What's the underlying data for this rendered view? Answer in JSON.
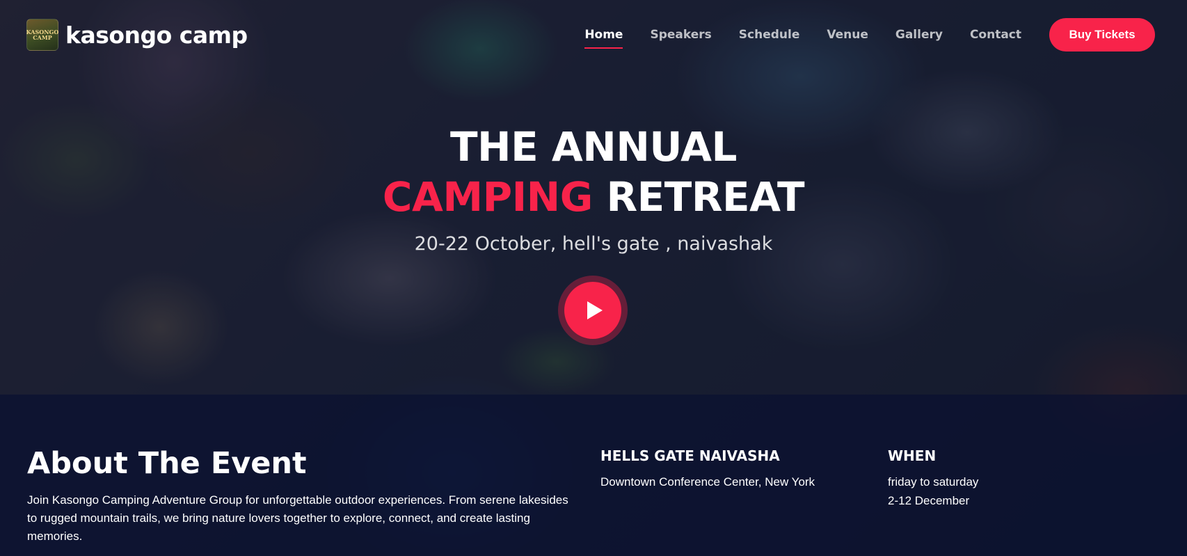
{
  "brand": {
    "logo_text": "KASONGO CAMP",
    "name": "kasongo camp"
  },
  "nav": {
    "links": [
      {
        "label": "Home",
        "active": true
      },
      {
        "label": "Speakers",
        "active": false
      },
      {
        "label": "Schedule",
        "active": false
      },
      {
        "label": "Venue",
        "active": false
      },
      {
        "label": "Gallery",
        "active": false
      },
      {
        "label": "Contact",
        "active": false
      }
    ],
    "cta_label": "Buy Tickets"
  },
  "hero": {
    "title_line1": "THE ANNUAL",
    "title_accent": "CAMPING",
    "title_line2_rest": " RETREAT",
    "subtitle": "20-22 October, hell's gate , naivashak",
    "play_icon": "play-icon"
  },
  "about": {
    "title": "About The Event",
    "text": "Join Kasongo Camping Adventure Group for unforgettable outdoor experiences. From serene lakesides to rugged mountain trails, we bring nature lovers together to explore, connect, and create lasting memories."
  },
  "venue": {
    "title": "HELLS GATE NAIVASHA",
    "line1": "Downtown Conference Center, New York"
  },
  "when": {
    "title": "WHEN",
    "line1": "friday to saturday",
    "line2": "2-12 December"
  },
  "colors": {
    "accent": "#f8234a",
    "overlay": "#080c23"
  }
}
